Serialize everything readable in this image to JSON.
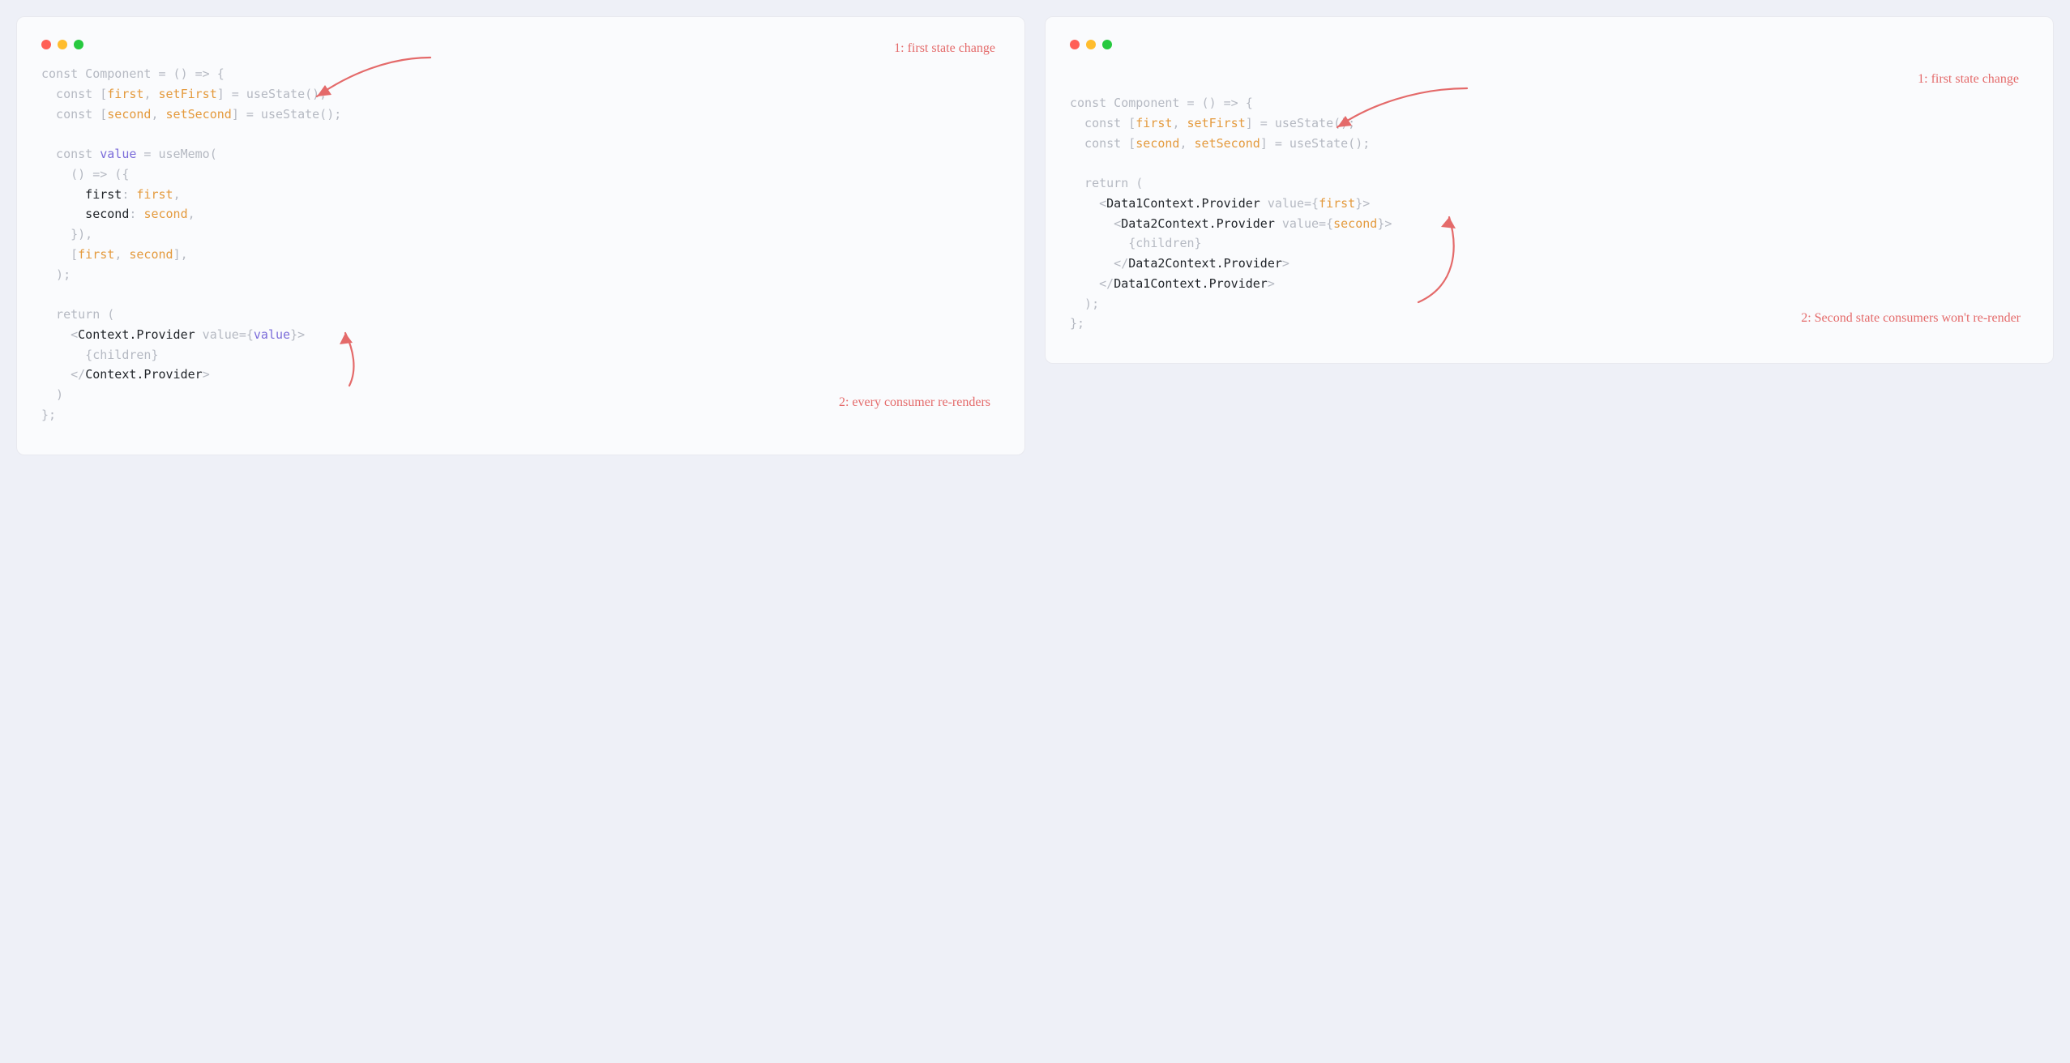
{
  "left": {
    "annot1": "1: first state change",
    "annot2": "2: every consumer re-renders",
    "code": {
      "l1a": "const",
      "l1b": " Component = () => {",
      "l2a": "  const",
      "l2b": " [",
      "l2c": "first",
      "l2d": ", ",
      "l2e": "setFirst",
      "l2f": "] = useState();",
      "l3a": "  const",
      "l3b": " [",
      "l3c": "second",
      "l3d": ", ",
      "l3e": "setSecond",
      "l3f": "] = useState();",
      "l4a": "  const ",
      "l4b": "value",
      "l4c": " = useMemo(",
      "l5": "    () => ({",
      "l6a": "      first",
      "l6b": ": ",
      "l6c": "first",
      "l6d": ",",
      "l7a": "      second",
      "l7b": ": ",
      "l7c": "second",
      "l7d": ",",
      "l8": "    }),",
      "l9a": "    [",
      "l9b": "first",
      "l9c": ", ",
      "l9d": "second",
      "l9e": "],",
      "l10": "  );",
      "l11": "  return (",
      "l12a": "    <",
      "l12b": "Context.Provider",
      "l12c": " value=",
      "l12d": "{",
      "l12e": "value",
      "l12f": "}",
      "l12g": ">",
      "l13": "      {children}",
      "l14a": "    </",
      "l14b": "Context.Provider",
      "l14c": ">",
      "l15": "  )",
      "l16": "};"
    }
  },
  "right": {
    "annot1": "1: first state change",
    "annot2": "2: Second state consumers won't re-render",
    "code": {
      "l1a": "const",
      "l1b": " Component = () => {",
      "l2a": "  const",
      "l2b": " [",
      "l2c": "first",
      "l2d": ", ",
      "l2e": "setFirst",
      "l2f": "] = useState();",
      "l3a": "  const",
      "l3b": " [",
      "l3c": "second",
      "l3d": ", ",
      "l3e": "setSecond",
      "l3f": "] = useState();",
      "l4": "  return (",
      "l5a": "    <",
      "l5b": "Data1Context.Provider",
      "l5c": " value=",
      "l5d": "{",
      "l5e": "first",
      "l5f": "}",
      "l5g": ">",
      "l6a": "      <",
      "l6b": "Data2Context.Provider",
      "l6c": " value=",
      "l6d": "{",
      "l6e": "second",
      "l6f": "}",
      "l6g": ">",
      "l7": "        {children}",
      "l8a": "      </",
      "l8b": "Data2Context.Provider",
      "l8c": ">",
      "l9a": "    </",
      "l9b": "Data1Context.Provider",
      "l9c": ">",
      "l10": "  );",
      "l11": "};"
    }
  }
}
